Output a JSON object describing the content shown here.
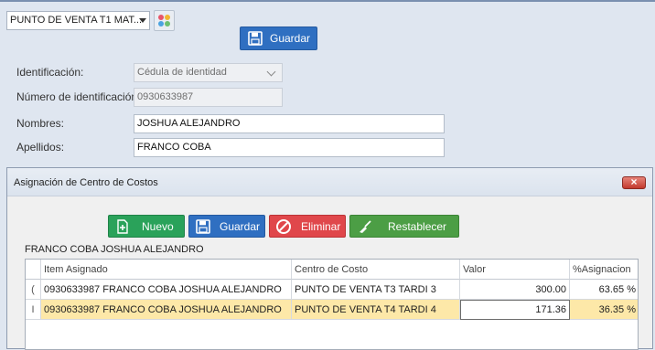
{
  "toolbar": {
    "location_select": "PUNTO DE VENTA T1 MAT...",
    "save_label": "Guardar"
  },
  "form": {
    "id_type_label": "Identificación:",
    "id_type_value": "Cédula de identidad",
    "id_number_label": "Número de identificación:",
    "id_number_value": "0930633987",
    "names_label": "Nombres:",
    "names_value": "JOSHUA ALEJANDRO",
    "surnames_label": "Apellidos:",
    "surnames_value": "FRANCO COBA"
  },
  "dialog": {
    "title": "Asignación de Centro de Costos",
    "close_glyph": "×",
    "buttons": {
      "new": "Nuevo",
      "save": "Guardar",
      "delete": "Eliminar",
      "reset": "Restablecer"
    },
    "person_name": "FRANCO COBA JOSHUA ALEJANDRO",
    "grid": {
      "headers": [
        "Item Asignado",
        "Centro de Costo",
        "Valor",
        "%Asignacion"
      ],
      "rows": [
        {
          "indicator": "(",
          "item": "0930633987  FRANCO COBA JOSHUA ALEJANDRO",
          "center": "PUNTO DE VENTA T3 TARDI 3",
          "value": "300.00",
          "percent": "63.65 %"
        },
        {
          "indicator": "I",
          "item": "0930633987  FRANCO COBA JOSHUA ALEJANDRO",
          "center": "PUNTO DE VENTA T4 TARDI 4",
          "value": "171.36",
          "percent": "36.35 %"
        }
      ]
    }
  },
  "colors": {
    "primary_blue": "#2f6fc1",
    "new_green": "#2aa25a",
    "delete_red": "#e0474b",
    "reset_green": "#4c9e45",
    "selected_row": "#fde8a8"
  }
}
